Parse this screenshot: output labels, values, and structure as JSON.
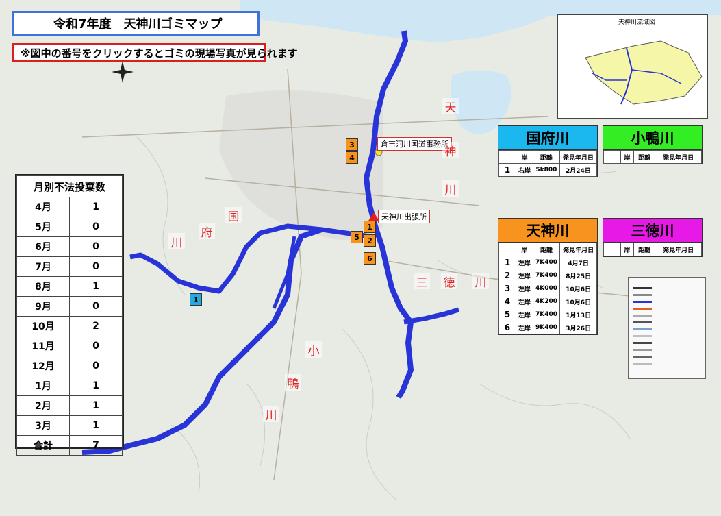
{
  "title": "令和7年度　天神川ゴミマップ",
  "note": "※図中の番号をクリックするとゴミの現場写真が見られます",
  "inset_label": "天神川流域図",
  "offices": {
    "kurayoshi": "倉吉河川国道事務所",
    "tenjin": "天神川出張所"
  },
  "monthly": {
    "header": "月別不法投棄数",
    "rows": [
      {
        "month": "4月",
        "count": "1"
      },
      {
        "month": "5月",
        "count": "0"
      },
      {
        "month": "6月",
        "count": "0"
      },
      {
        "month": "7月",
        "count": "0"
      },
      {
        "month": "8月",
        "count": "1"
      },
      {
        "month": "9月",
        "count": "0"
      },
      {
        "month": "10月",
        "count": "2"
      },
      {
        "month": "11月",
        "count": "0"
      },
      {
        "month": "12月",
        "count": "0"
      },
      {
        "month": "1月",
        "count": "1"
      },
      {
        "month": "2月",
        "count": "1"
      },
      {
        "month": "3月",
        "count": "1"
      }
    ],
    "total_label": "合計",
    "total": "7"
  },
  "rivers": {
    "kokufu": {
      "name": "国府川",
      "color": "#1ab8ee",
      "cols": [
        "岸",
        "距離",
        "発見年月日"
      ],
      "rows": [
        {
          "no": "1",
          "bank": "右岸",
          "dist": "5k800",
          "date": "2月24日"
        }
      ]
    },
    "kogamo": {
      "name": "小鴨川",
      "color": "#33ee22",
      "cols": [
        "岸",
        "距離",
        "発見年月日"
      ],
      "rows": []
    },
    "tenjin": {
      "name": "天神川",
      "color": "#f7931e",
      "cols": [
        "岸",
        "距離",
        "発見年月日"
      ],
      "rows": [
        {
          "no": "1",
          "bank": "左岸",
          "dist": "7K400",
          "date": "4月7日"
        },
        {
          "no": "2",
          "bank": "左岸",
          "dist": "7K400",
          "date": "8月25日"
        },
        {
          "no": "3",
          "bank": "左岸",
          "dist": "4K000",
          "date": "10月6日"
        },
        {
          "no": "4",
          "bank": "左岸",
          "dist": "4K200",
          "date": "10月6日"
        },
        {
          "no": "5",
          "bank": "左岸",
          "dist": "7K400",
          "date": "1月13日"
        },
        {
          "no": "6",
          "bank": "左岸",
          "dist": "9K400",
          "date": "3月26日"
        }
      ]
    },
    "mitoku": {
      "name": "三徳川",
      "color": "#e619e6",
      "cols": [
        "岸",
        "距離",
        "発見年月日"
      ],
      "rows": []
    }
  },
  "river_labels": {
    "tenjin": [
      "天",
      "神",
      "川"
    ],
    "kokufu": [
      "国",
      "府",
      "川"
    ],
    "kogamo": [
      "小",
      "鴨",
      "川"
    ],
    "mitoku": [
      "三",
      "徳",
      "川"
    ]
  },
  "markers": {
    "tenjin": [
      "1",
      "2",
      "3",
      "4",
      "5",
      "6"
    ],
    "kokufu": [
      "1"
    ]
  }
}
